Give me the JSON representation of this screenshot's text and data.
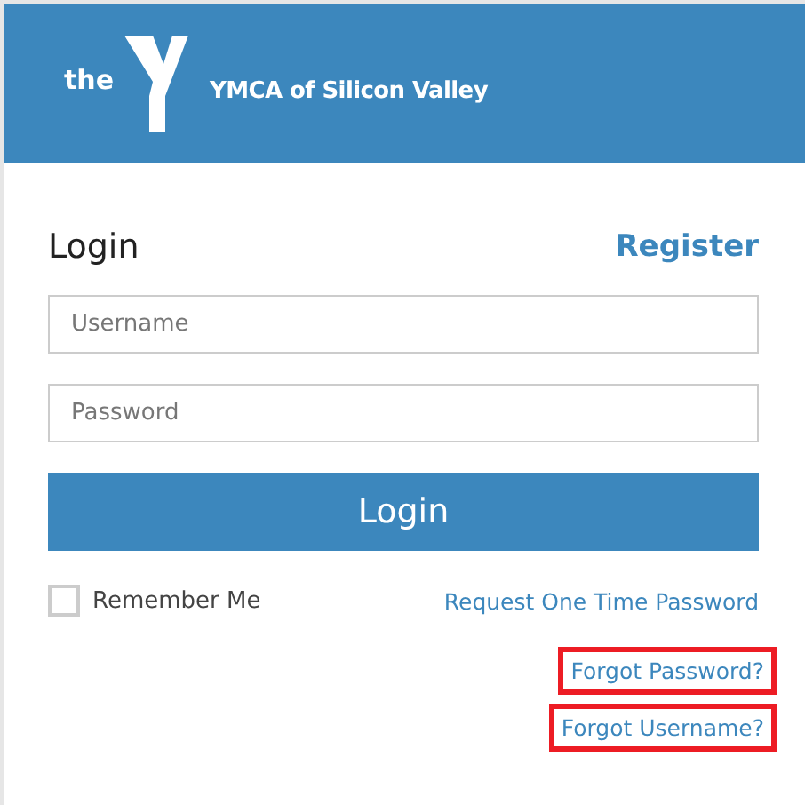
{
  "header": {
    "logo_prefix": "the",
    "org_name": "YMCA of Silicon Valley"
  },
  "form": {
    "title": "Login",
    "register_link": "Register",
    "fields": [
      {
        "placeholder": "Username"
      },
      {
        "placeholder": "Password"
      }
    ],
    "submit": "Login",
    "remember": {
      "label": "Remember Me",
      "checked": false
    },
    "otp_link": "Request One Time Password",
    "links": [
      {
        "label": "Forgot Password?",
        "highlighted": true
      },
      {
        "label": "Forgot Username?",
        "highlighted": true
      }
    ]
  }
}
